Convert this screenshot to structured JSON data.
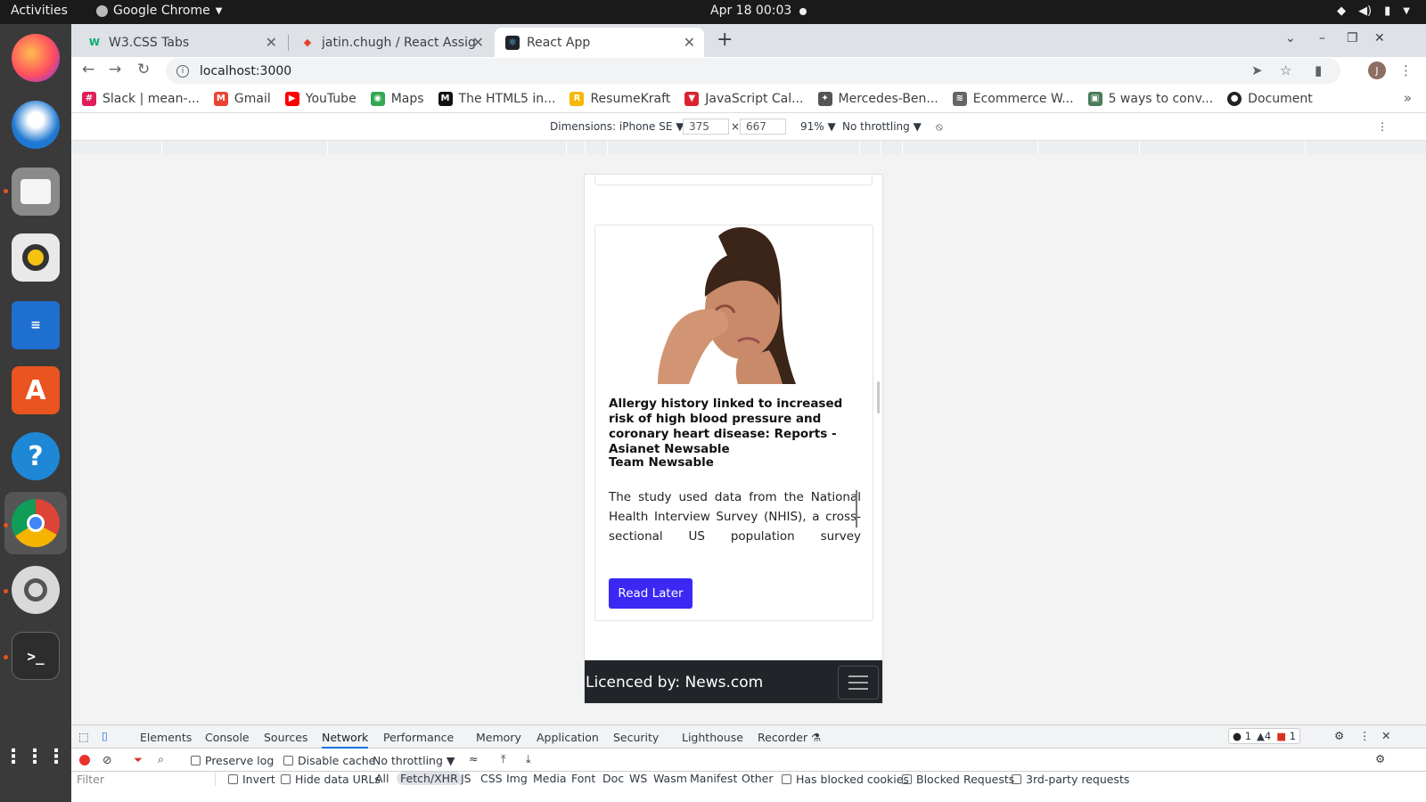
{
  "system_bar": {
    "activities": "Activities",
    "app_name": "Google Chrome",
    "clock": "Apr 18  00:03"
  },
  "dock": {
    "items": [
      "firefox-icon",
      "thunderbird-icon",
      "files-icon",
      "rhythmbox-icon",
      "writer-icon",
      "software-icon",
      "help-icon",
      "chrome-icon",
      "settings-icon",
      "terminal-icon",
      "app-grid-icon"
    ]
  },
  "browser": {
    "tabs": [
      {
        "label": "W3.CSS Tabs",
        "favicon": "W"
      },
      {
        "label": "jatin.chugh / React Assign",
        "favicon": "gitlab"
      },
      {
        "label": "React App",
        "favicon": "react"
      }
    ],
    "url": "localhost:3000",
    "avatar_initial": "J",
    "bookmarks": [
      {
        "label": "Slack | mean-...",
        "color": "#e01e5a"
      },
      {
        "label": "Gmail",
        "color": "#ea4335"
      },
      {
        "label": "YouTube",
        "color": "#ff0000"
      },
      {
        "label": "Maps",
        "color": "#34a853"
      },
      {
        "label": "The HTML5 in...",
        "color": "#111111"
      },
      {
        "label": "ResumeKraft",
        "color": "#f5b800"
      },
      {
        "label": "JavaScript Cal...",
        "color": "#d9232e"
      },
      {
        "label": "Mercedes-Ben...",
        "color": "#555555"
      },
      {
        "label": "Ecommerce W...",
        "color": "#666666"
      },
      {
        "label": "5 ways to conv...",
        "color": "#4a7c59"
      },
      {
        "label": "Document",
        "color": "#222222"
      }
    ]
  },
  "device_toolbar": {
    "dimensions_label": "Dimensions: iPhone SE",
    "width": "375",
    "times": "×",
    "height": "667",
    "zoom": "91%",
    "throttling": "No throttling"
  },
  "article": {
    "title": "Allergy history linked to increased risk of high blood pressure and coronary heart disease: Reports - Asianet Newsable",
    "author": "Team Newsable",
    "description": "The study used data from the National Health Interview Survey (NHIS), a cross-sectional US population survey conducted annually by the National Center for Health Statistics.",
    "button": "Read Later"
  },
  "footer": {
    "text": "Licenced by: News.com"
  },
  "devtools": {
    "tabs": [
      "Elements",
      "Console",
      "Sources",
      "Network",
      "Performance",
      "Memory",
      "Application",
      "Security",
      "Lighthouse",
      "Recorder"
    ],
    "active_tab": "Network",
    "counters": {
      "errors": "1",
      "warnings": "4",
      "issues": "1"
    },
    "preserve_log": "Preserve log",
    "disable_cache": "Disable cache",
    "throttling": "No throttling",
    "filter_placeholder": "Filter",
    "invert": "Invert",
    "hide_data_urls": "Hide data URLs",
    "types": [
      "All",
      "Fetch/XHR",
      "JS",
      "CSS",
      "Img",
      "Media",
      "Font",
      "Doc",
      "WS",
      "Wasm",
      "Manifest",
      "Other"
    ],
    "active_type": "Fetch/XHR",
    "has_blocked_cookies": "Has blocked cookies",
    "blocked_requests": "Blocked Requests",
    "third_party": "3rd-party requests"
  }
}
